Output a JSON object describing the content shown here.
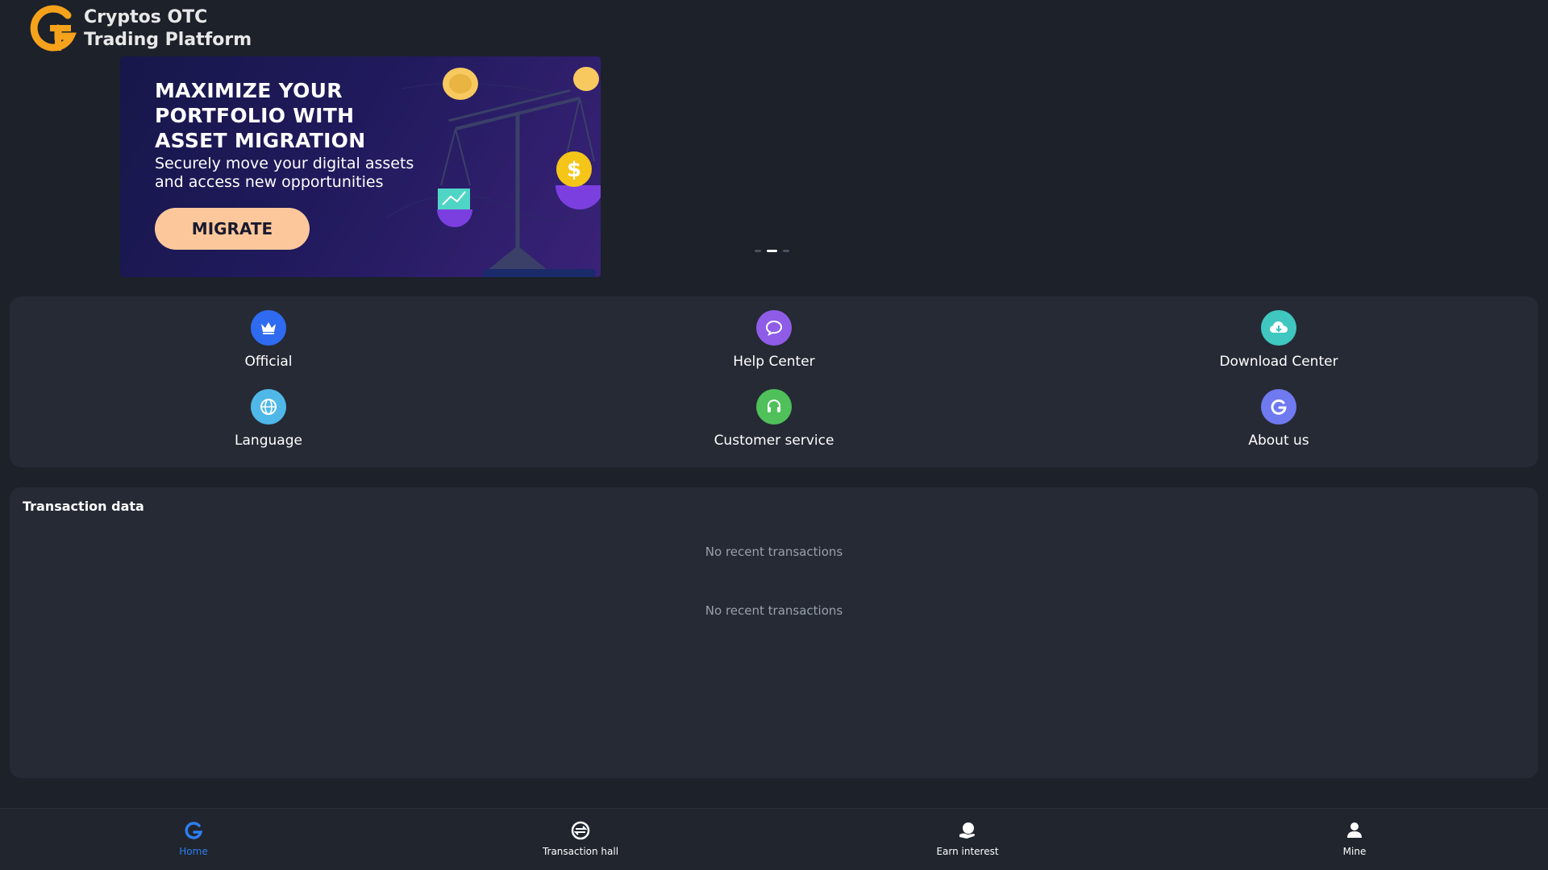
{
  "header": {
    "brand_line1": "Cryptos  OTC",
    "brand_line2": "Trading  Platform"
  },
  "banner": {
    "title_line1": "MAXIMIZE YOUR",
    "title_line2": "PORTFOLIO WITH",
    "title_line3": "ASSET MIGRATION",
    "subtitle_line1": "Securely move your digital assets",
    "subtitle_line2": "and access new opportunities",
    "button_label": "MIGRATE",
    "dollar_symbol": "$"
  },
  "carousel": {
    "slide_count": 3,
    "active_index": 1
  },
  "menu": {
    "items": [
      {
        "label": "Official",
        "icon": "crown-icon",
        "color": "#2f6bf0"
      },
      {
        "label": "Help Center",
        "icon": "chat-bubble-icon",
        "color": "#8f5ce8"
      },
      {
        "label": "Download Center",
        "icon": "cloud-download-icon",
        "color": "#3fc7c0"
      },
      {
        "label": "Language",
        "icon": "globe-icon",
        "color": "#4fb8e8"
      },
      {
        "label": "Customer service",
        "icon": "headset-icon",
        "color": "#4fc05a"
      },
      {
        "label": "About us",
        "icon": "brand-g-icon",
        "color": "#6f79f0"
      }
    ]
  },
  "transactions": {
    "title": "Transaction data",
    "empty_1": "No recent transactions",
    "empty_2": "No recent transactions"
  },
  "bottom_nav": {
    "items": [
      {
        "label": "Home",
        "icon": "home-brand-icon",
        "active": true
      },
      {
        "label": "Transaction hall",
        "icon": "exchange-icon",
        "active": false
      },
      {
        "label": "Earn interest",
        "icon": "earn-icon",
        "active": false
      },
      {
        "label": "Mine",
        "icon": "user-icon",
        "active": false
      }
    ]
  },
  "colors": {
    "accent": "#2f7ff0",
    "background": "#1c212a",
    "panel": "#252a35",
    "brand_orange": "#f7a21b"
  }
}
